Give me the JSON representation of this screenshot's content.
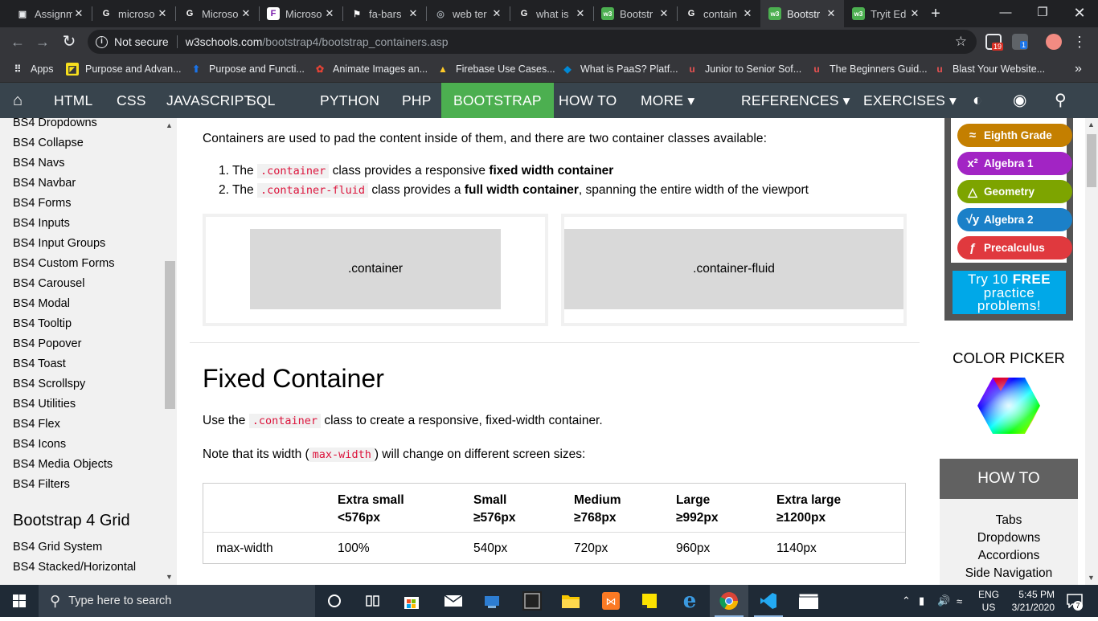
{
  "browser": {
    "tabs": [
      {
        "label": "Assignm",
        "favicon": "assignment-icon",
        "color": "#e8eaed",
        "glyph": "▣"
      },
      {
        "label": "microso",
        "favicon": "google-icon",
        "color": "#ffffff",
        "glyph": "G"
      },
      {
        "label": "Microso",
        "favicon": "google-icon",
        "color": "#ffffff",
        "glyph": "G"
      },
      {
        "label": "Microso",
        "favicon": "microsoft-forms-icon",
        "color": "#ffffff",
        "glyph": "F"
      },
      {
        "label": "fa-bars",
        "favicon": "flag-icon",
        "color": "#ffffff",
        "glyph": "⚑"
      },
      {
        "label": "web ter",
        "favicon": "globe-icon",
        "color": "#9aa0a6",
        "glyph": "◎"
      },
      {
        "label": "what is",
        "favicon": "google-icon",
        "color": "#ffffff",
        "glyph": "G"
      },
      {
        "label": "Bootstr",
        "favicon": "w3schools-icon",
        "color": "#4caf50",
        "glyph": "w3"
      },
      {
        "label": "contain",
        "favicon": "google-icon",
        "color": "#ffffff",
        "glyph": "G"
      },
      {
        "label": "Bootstr",
        "favicon": "w3schools-icon",
        "color": "#4caf50",
        "glyph": "w3"
      },
      {
        "label": "Tryit Ed",
        "favicon": "w3schools-icon",
        "color": "#4caf50",
        "glyph": "w3"
      }
    ],
    "active_tab_index": 9,
    "address": {
      "security": "Not secure",
      "host": "w3schools.com",
      "path": "/bootstrap4/bootstrap_containers.asp"
    },
    "extension_badges": {
      "first": "19",
      "second": "1"
    },
    "bookmarks": [
      {
        "label": "Apps",
        "icon": "apps-grid-icon",
        "color": "#e8eaed"
      },
      {
        "label": "Purpose and Advan...",
        "icon": "bookmark-icon",
        "color": "#f7df1e"
      },
      {
        "label": "Purpose and Functi...",
        "icon": "upload-icon",
        "color": "#1a73e8"
      },
      {
        "label": "Animate Images an...",
        "icon": "flower-icon",
        "color": "#e94335"
      },
      {
        "label": "Firebase Use Cases...",
        "icon": "firebase-icon",
        "color": "#ffca28"
      },
      {
        "label": "What is PaaS? Platf...",
        "icon": "azure-icon",
        "color": "#0089d6"
      },
      {
        "label": "Junior to Senior Sof...",
        "icon": "udemy-icon",
        "color": "#ec5252"
      },
      {
        "label": "The Beginners Guid...",
        "icon": "udemy-icon",
        "color": "#ec5252"
      },
      {
        "label": "Blast Your Website...",
        "icon": "udemy-icon",
        "color": "#ec5252"
      }
    ],
    "bookmarks_more": "»"
  },
  "topnav": {
    "items": [
      "HTML",
      "CSS",
      "JAVASCRIPT",
      "SQL",
      "PYTHON",
      "PHP",
      "BOOTSTRAP",
      "HOW TO",
      "MORE ▾"
    ],
    "right_items": [
      "REFERENCES ▾",
      "EXERCISES ▾"
    ],
    "active": "BOOTSTRAP",
    "accent": "#4caf50",
    "bg": "#38444d"
  },
  "sidebar": {
    "items": [
      "BS4 Dropdowns",
      "BS4 Collapse",
      "BS4 Navs",
      "BS4 Navbar",
      "BS4 Forms",
      "BS4 Inputs",
      "BS4 Input Groups",
      "BS4 Custom Forms",
      "BS4 Carousel",
      "BS4 Modal",
      "BS4 Tooltip",
      "BS4 Popover",
      "BS4 Toast",
      "BS4 Scrollspy",
      "BS4 Utilities",
      "BS4 Flex",
      "BS4 Icons",
      "BS4 Media Objects",
      "BS4 Filters"
    ],
    "grid_heading": "Bootstrap 4 Grid",
    "grid_items": [
      "BS4 Grid System",
      "BS4 Stacked/Horizontal"
    ]
  },
  "main": {
    "intro": "Containers are used to pad the content inside of them, and there are two container classes available:",
    "list": [
      {
        "num": "1.",
        "pre": "The",
        "code": ".container",
        "mid": "class provides a responsive",
        "bold": "fixed width container",
        "post": ""
      },
      {
        "num": "2.",
        "pre": "The",
        "code": ".container-fluid",
        "mid": "class provides a",
        "bold": "full width container",
        "post": ", spanning the entire width of the viewport"
      }
    ],
    "demo_boxes": [
      ".container",
      ".container-fluid"
    ],
    "heading": "Fixed Container",
    "para1": {
      "pre": "Use the",
      "code": ".container",
      "post": "class to create a responsive, fixed-width container."
    },
    "para2": {
      "pre": "Note that its width (",
      "code": "max-width",
      "post": ") will change on different screen sizes:"
    },
    "table": {
      "headers": [
        [
          "",
          ""
        ],
        [
          "Extra small",
          "<576px"
        ],
        [
          "Small",
          "≥576px"
        ],
        [
          "Medium",
          "≥768px"
        ],
        [
          "Large",
          "≥992px"
        ],
        [
          "Extra large",
          "≥1200px"
        ]
      ],
      "row": [
        "max-width",
        "100%",
        "540px",
        "720px",
        "960px",
        "1140px"
      ]
    }
  },
  "rightcol": {
    "pills": [
      {
        "label": "Eighth Grade",
        "icon": "approx-icon",
        "glyph": "≈",
        "color": "#c47f00"
      },
      {
        "label": "Algebra 1",
        "icon": "x-squared-icon",
        "glyph": "x²",
        "color": "#a224c4"
      },
      {
        "label": "Geometry",
        "icon": "triangle-icon",
        "glyph": "△",
        "color": "#7da400"
      },
      {
        "label": "Algebra 2",
        "icon": "sqrt-icon",
        "glyph": "√y",
        "color": "#1b80c8"
      },
      {
        "label": "Precalculus",
        "icon": "function-icon",
        "glyph": "ƒ",
        "color": "#e0393e"
      }
    ],
    "promo": {
      "line1": "Try 10",
      "highlight": "FREE",
      "line2": "practice",
      "line3": "problems!"
    },
    "color_picker_title": "COLOR PICKER",
    "howto_title": "HOW TO",
    "howto_items": [
      "Tabs",
      "Dropdowns",
      "Accordions",
      "Side Navigation"
    ]
  },
  "taskbar": {
    "search_placeholder": "Type here to search",
    "lang_top": "ENG",
    "lang_bottom": "US",
    "time": "5:45 PM",
    "date": "3/21/2020",
    "notification_count": "7"
  }
}
